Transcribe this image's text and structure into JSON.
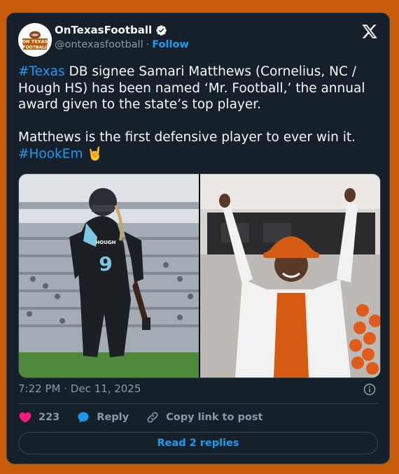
{
  "account": {
    "display_name": "OnTexasFootball",
    "handle": "@ontexasfootball",
    "separator": "·",
    "follow_label": "Follow",
    "avatar_text_top": "ON TEXAS",
    "avatar_text_bottom": "FOOTBALL",
    "verified_icon": "verified-badge-icon"
  },
  "tweet": {
    "hashtag_1": "#Texas",
    "text_1": " DB signee Samari Matthews (Cornelius, NC / Hough HS) has been named ‘Mr. Football,’ the annual award given to the state’s top player.\n\nMatthews is the first defensive player to ever win it. ",
    "hashtag_2": "#HookEm",
    "emoji": "🤘"
  },
  "media": {
    "left_jersey_school": "HOUGH",
    "left_jersey_number": "9"
  },
  "meta": {
    "time": "7:22 PM",
    "separator": "·",
    "date": "Dec 11, 2025"
  },
  "actions": {
    "like_count": "223",
    "reply_label": "Reply",
    "copy_label": "Copy link to post"
  },
  "replies_button": "Read 2 replies",
  "colors": {
    "background": "#c75d0a",
    "card": "#15202b",
    "accent": "#1d9bf0",
    "like": "#f91880",
    "muted": "#8b98a5",
    "border": "#38444d"
  }
}
